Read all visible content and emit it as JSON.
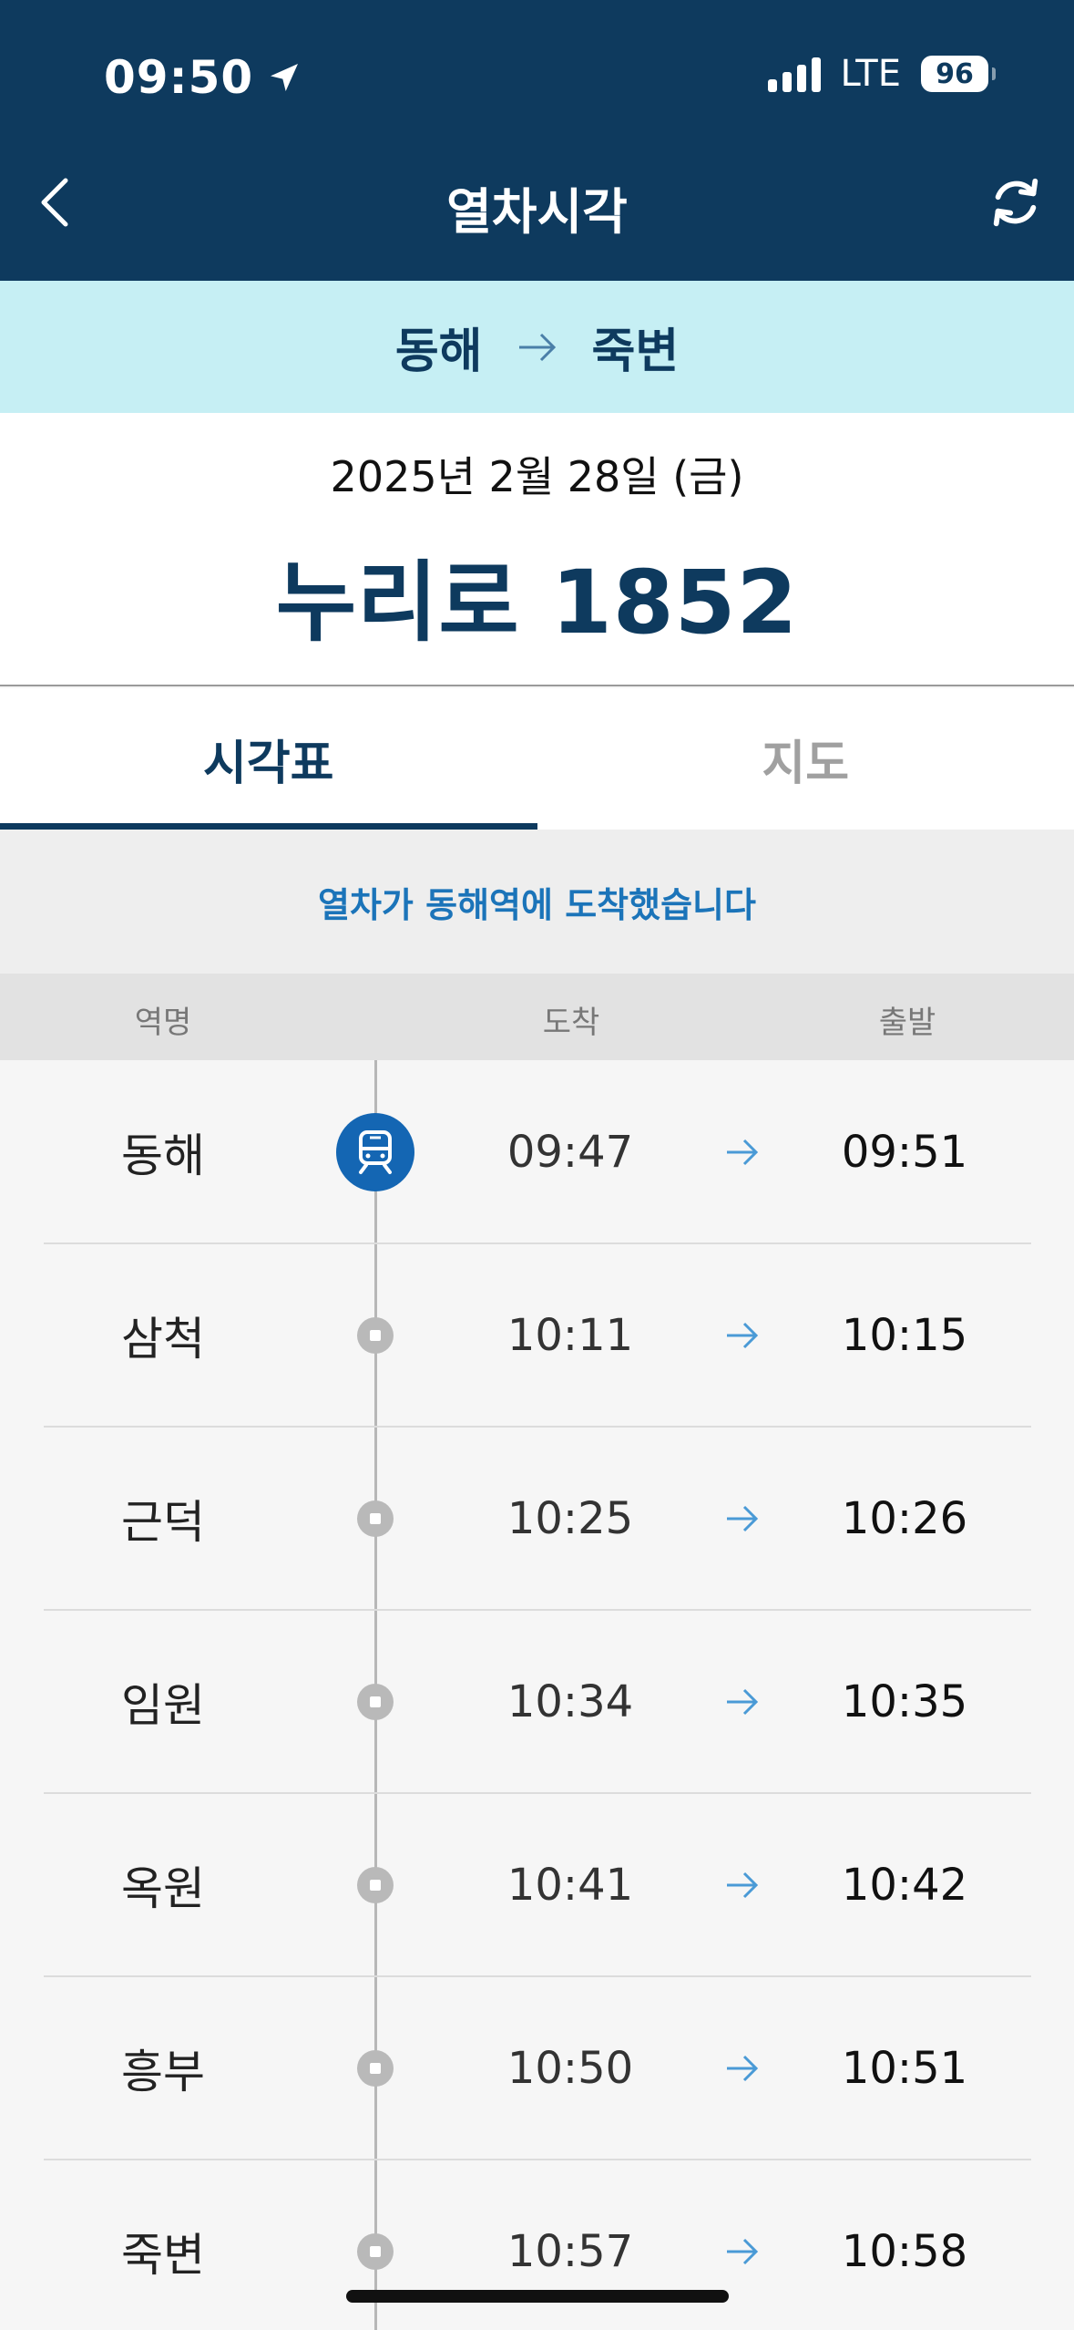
{
  "status_bar": {
    "time": "09:50",
    "network": "LTE",
    "battery": "96"
  },
  "nav": {
    "title": "열차시각",
    "back_icon": "chevron-left-icon",
    "refresh_icon": "refresh-icon"
  },
  "route": {
    "from": "동해",
    "to": "죽변"
  },
  "train_info": {
    "date": "2025년 2월 28일 (금)",
    "train_name": "누리로 1852"
  },
  "tabs": [
    {
      "label": "시각표",
      "active": true
    },
    {
      "label": "지도",
      "active": false
    }
  ],
  "notice": "열차가 동해역에 도착했습니다",
  "columns": {
    "station": "역명",
    "arrival": "도착",
    "departure": "출발"
  },
  "stops": [
    {
      "station": "동해",
      "arrival": "09:47",
      "departure": "09:51",
      "current": true
    },
    {
      "station": "삼척",
      "arrival": "10:11",
      "departure": "10:15",
      "current": false
    },
    {
      "station": "근덕",
      "arrival": "10:25",
      "departure": "10:26",
      "current": false
    },
    {
      "station": "임원",
      "arrival": "10:34",
      "departure": "10:35",
      "current": false
    },
    {
      "station": "옥원",
      "arrival": "10:41",
      "departure": "10:42",
      "current": false
    },
    {
      "station": "흥부",
      "arrival": "10:50",
      "departure": "10:51",
      "current": false
    },
    {
      "station": "죽변",
      "arrival": "10:57",
      "departure": "10:58",
      "current": false
    }
  ],
  "colors": {
    "header_bg": "#0e3a5e",
    "route_bg": "#c6eff4",
    "accent_blue": "#1466b3",
    "notice_text": "#1b74b9",
    "arrow_blue": "#4a9ad6"
  }
}
